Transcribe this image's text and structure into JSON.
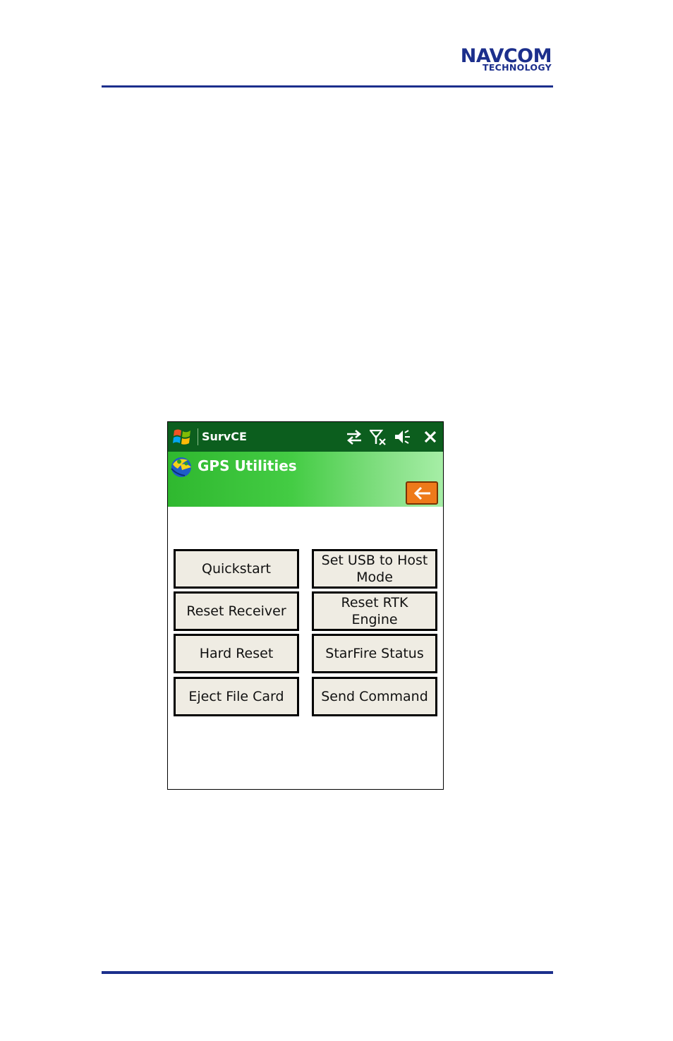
{
  "brand": {
    "line1": "NAVCOM",
    "line2": "TECHNOLOGY",
    "color": "#1c2f8c"
  },
  "titlebar": {
    "app_name": "SurvCE",
    "icons": [
      "windows-start-icon",
      "connectivity-arrows-icon",
      "no-signal-icon",
      "speaker-muted-icon",
      "close-icon"
    ],
    "close_glyph": "✕"
  },
  "header": {
    "title": "GPS Utilities",
    "back_glyph": "←"
  },
  "buttons": {
    "quickstart": "Quickstart",
    "set_usb_host": "Set USB to Host Mode",
    "reset_receiver": "Reset Receiver",
    "reset_rtk": "Reset RTK Engine",
    "hard_reset": "Hard Reset",
    "starfire_status": "StarFire Status",
    "eject_card": "Eject File Card",
    "send_command": "Send Command"
  },
  "colors": {
    "titlebar": "#0c5e1e",
    "header_gradient_start": "#2fb82f",
    "back_button": "#ee7a1a",
    "button_face": "#efece3"
  }
}
